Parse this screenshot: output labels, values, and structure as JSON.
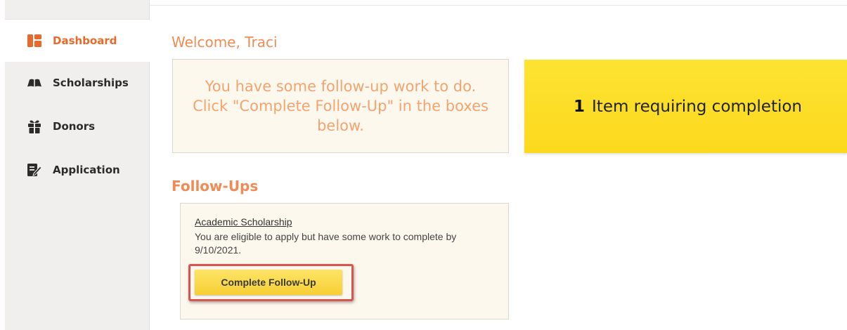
{
  "sidebar": {
    "items": [
      {
        "label": "Dashboard",
        "icon": "dashboard-icon",
        "active": true
      },
      {
        "label": "Scholarships",
        "icon": "book-icon",
        "active": false
      },
      {
        "label": "Donors",
        "icon": "gift-icon",
        "active": false
      },
      {
        "label": "Application",
        "icon": "edit-document-icon",
        "active": false
      }
    ]
  },
  "main": {
    "welcome": "Welcome, Traci",
    "notice": "You have some follow-up work to do. Click \"Complete Follow-Up\" in the boxes below.",
    "completion": {
      "count": "1",
      "label": "Item requiring completion"
    },
    "followups_title": "Follow-Ups",
    "followup_card": {
      "title": "Academic Scholarship",
      "description": "You are eligible to apply but have some work to complete by 9/10/2021.",
      "button_label": "Complete Follow-Up"
    }
  },
  "colors": {
    "accent_orange": "#e86a2a",
    "heading_orange": "#f08b56",
    "notice_yellow": "#fde332",
    "button_yellow": "#f7cf34",
    "highlight_red": "#d9534f"
  }
}
